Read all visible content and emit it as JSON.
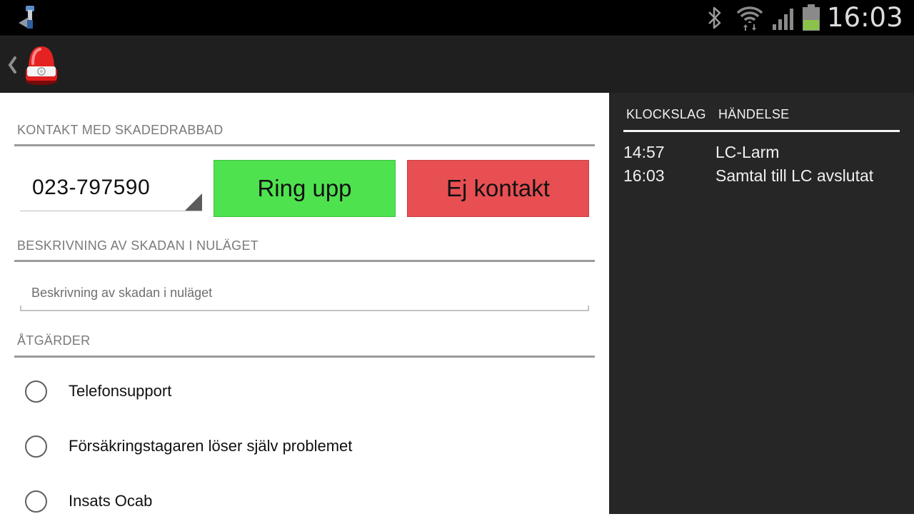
{
  "status_bar": {
    "time": "16:03",
    "icons": [
      "download-notification-icon",
      "bluetooth-icon",
      "wifi-icon",
      "signal-icon",
      "battery-icon"
    ]
  },
  "action_bar": {
    "icons": [
      "back-chevron-icon",
      "siren-app-icon"
    ]
  },
  "form": {
    "contact_header": "KONTAKT MED SKADEDRABBAD",
    "phone_value": "023-797590",
    "call_button": "Ring upp",
    "no_contact_button": "Ej kontakt",
    "description_header": "BESKRIVNING AV SKADAN I NULÄGET",
    "description_placeholder": "Beskrivning av skadan i nuläget",
    "actions_header": "ÅTGÄRDER",
    "actions": [
      {
        "label": "Telefonsupport",
        "checked": false
      },
      {
        "label": "Försäkringstagaren löser själv problemet",
        "checked": false
      },
      {
        "label": "Insats Ocab",
        "checked": false
      }
    ]
  },
  "log": {
    "time_header": "KLOCKSLAG",
    "event_header": "HÄNDELSE",
    "rows": [
      {
        "time": "14:57",
        "event": "LC-Larm"
      },
      {
        "time": "16:03",
        "event": "Samtal till LC avslutat"
      }
    ]
  },
  "colors": {
    "call_button": "#4fe24f",
    "no_contact_button": "#e84f52",
    "battery_level": "#8bc34a"
  }
}
